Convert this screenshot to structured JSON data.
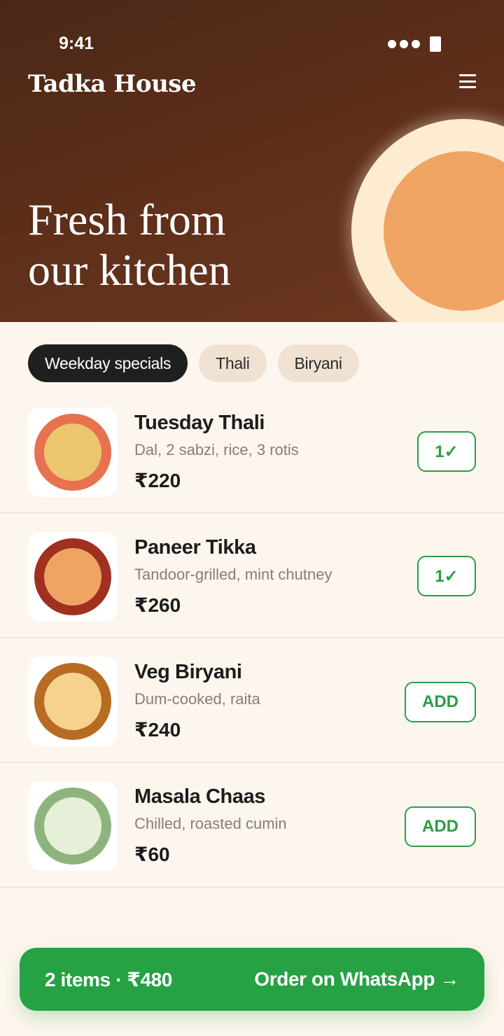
{
  "status_bar": {
    "time": "9:41"
  },
  "header": {
    "brand": "Tadka House",
    "menu_icon": "hamburger-menu-icon"
  },
  "hero": {
    "title_line1": "Fresh from",
    "title_line2": "our kitchen"
  },
  "categories": [
    {
      "label": "Weekday specials",
      "active": true
    },
    {
      "label": "Thali",
      "active": false
    },
    {
      "label": "Biryani",
      "active": false
    }
  ],
  "menu_items": [
    {
      "name": "Tuesday Thali",
      "description": "Dal, 2 sabzi, rice, 3 rotis",
      "price": "₹220",
      "button": "1✓",
      "in_cart": true,
      "ring_color": "#e8714f",
      "fill_color": "#ebc66e"
    },
    {
      "name": "Paneer Tikka",
      "description": "Tandoor-grilled, mint chutney",
      "price": "₹260",
      "button": "1✓",
      "in_cart": true,
      "ring_color": "#a03020",
      "fill_color": "#f0a464"
    },
    {
      "name": "Veg Biryani",
      "description": "Dum-cooked, raita",
      "price": "₹240",
      "button": "ADD",
      "in_cart": false,
      "ring_color": "#b86b22",
      "fill_color": "#f6d28e"
    },
    {
      "name": "Masala Chaas",
      "description": "Chilled, roasted cumin",
      "price": "₹60",
      "button": "ADD",
      "in_cart": false,
      "ring_color": "#8eb47e",
      "fill_color": "#e6efd8"
    }
  ],
  "cart": {
    "summary": "2 items · ₹480",
    "cta": "Order on WhatsApp →"
  },
  "colors": {
    "accent_green": "#26a244",
    "hero_brown": "#5c2e1a",
    "background": "#fdf6ee"
  }
}
